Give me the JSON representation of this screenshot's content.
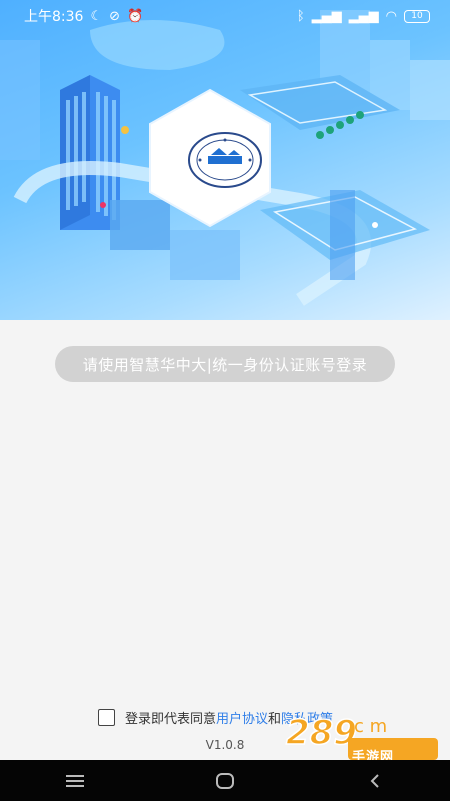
{
  "status_bar": {
    "time": "上午8:36",
    "battery": "10"
  },
  "login": {
    "button_label": "请使用智慧华中大|统一身份认证账号登录"
  },
  "agreement": {
    "prefix": "登录即代表同意",
    "user_agreement": "用户协议",
    "conjunction": "和",
    "privacy_policy": "隐私政策"
  },
  "version": "V1.0.8",
  "watermark": {
    "brand": "289",
    "suffix": "c m",
    "text": "手游网"
  },
  "colors": {
    "link": "#2f7ee8",
    "hero_sky": "#4fb0ff",
    "button": "#d2d2d2"
  },
  "icons": {
    "status": [
      "moon-icon",
      "no-data-icon",
      "alarm-icon",
      "bluetooth-icon",
      "signal-icon",
      "wifi-icon",
      "battery-icon"
    ],
    "nav": [
      "menu-icon",
      "home-icon",
      "back-icon"
    ]
  }
}
